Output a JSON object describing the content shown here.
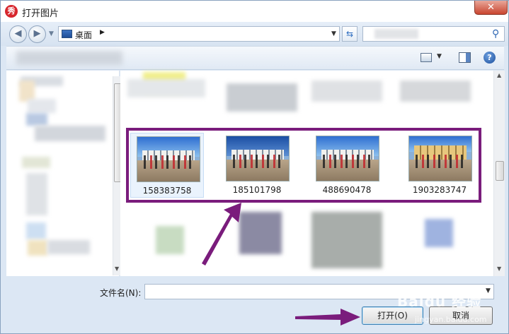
{
  "window": {
    "title": "打开图片",
    "app_icon_glyph": "秀",
    "close_glyph": "✕"
  },
  "address": {
    "location": "桌面",
    "back_glyph": "◀",
    "forward_glyph": "▶",
    "dropdown_glyph": "▼",
    "crumb_arrow": "▶",
    "refresh_glyph": "⇆",
    "search_glyph": "⚲"
  },
  "toolbar": {
    "help_glyph": "?"
  },
  "files": [
    {
      "name": "158383758"
    },
    {
      "name": "185101798"
    },
    {
      "name": "488690478"
    },
    {
      "name": "1903283747"
    }
  ],
  "footer": {
    "filename_label": "文件名(N):",
    "filename_value": "",
    "open_label": "打开(O)",
    "cancel_label": "取消"
  },
  "watermark": {
    "text": "Baidu 经验",
    "sub": "jingyan.baidu.com"
  },
  "colors": {
    "highlight": "#7a1c7c",
    "arrow": "#7a1c7c"
  }
}
